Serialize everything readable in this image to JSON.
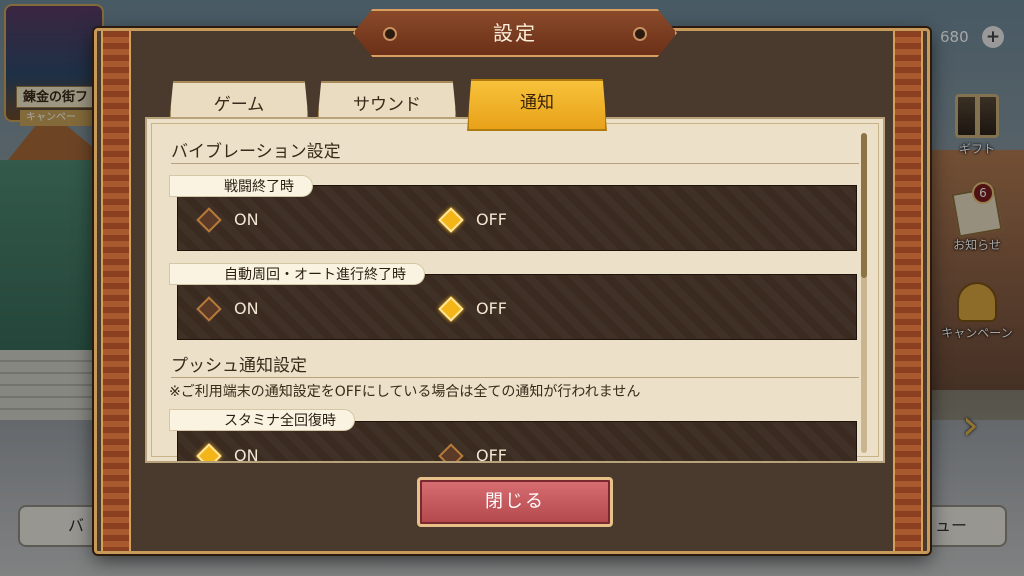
{
  "background": {
    "event_banner": {
      "title": "錬金の街フ",
      "subtitle": "キャンペー"
    },
    "currency": {
      "value": "680",
      "plus_label": "+"
    },
    "side_menu": [
      {
        "label": "ギフト",
        "icon": "gift-icon"
      },
      {
        "label": "お知らせ",
        "icon": "mail-icon",
        "badge": "6"
      },
      {
        "label": "キャンペーン",
        "icon": "bell-icon"
      }
    ],
    "next_arrow": "›",
    "bottom_left_label": "バ",
    "bottom_right_label": "ュー"
  },
  "dialog": {
    "title": "設定",
    "tabs": [
      {
        "label": "ゲーム",
        "active": false
      },
      {
        "label": "サウンド",
        "active": false
      },
      {
        "label": "通知",
        "active": true
      }
    ],
    "sections": {
      "vibration": {
        "title": "バイブレーション設定",
        "rows": [
          {
            "label": "戦闘終了時",
            "on_label": "ON",
            "off_label": "OFF",
            "selected": "OFF"
          },
          {
            "label": "自動周回・オート進行終了時",
            "on_label": "ON",
            "off_label": "OFF",
            "selected": "OFF"
          }
        ]
      },
      "push": {
        "title": "プッシュ通知設定",
        "notice": "※ご利用端末の通知設定をOFFにしている場合は全ての通知が行われません",
        "rows": [
          {
            "label": "スタミナ全回復時",
            "on_label": "ON",
            "off_label": "OFF",
            "selected": "ON"
          }
        ]
      }
    },
    "close_label": "閉じる"
  },
  "colors": {
    "accent_tab": "#f4b518",
    "close_button": "#c85a5e",
    "frame": "#8a3f20"
  }
}
